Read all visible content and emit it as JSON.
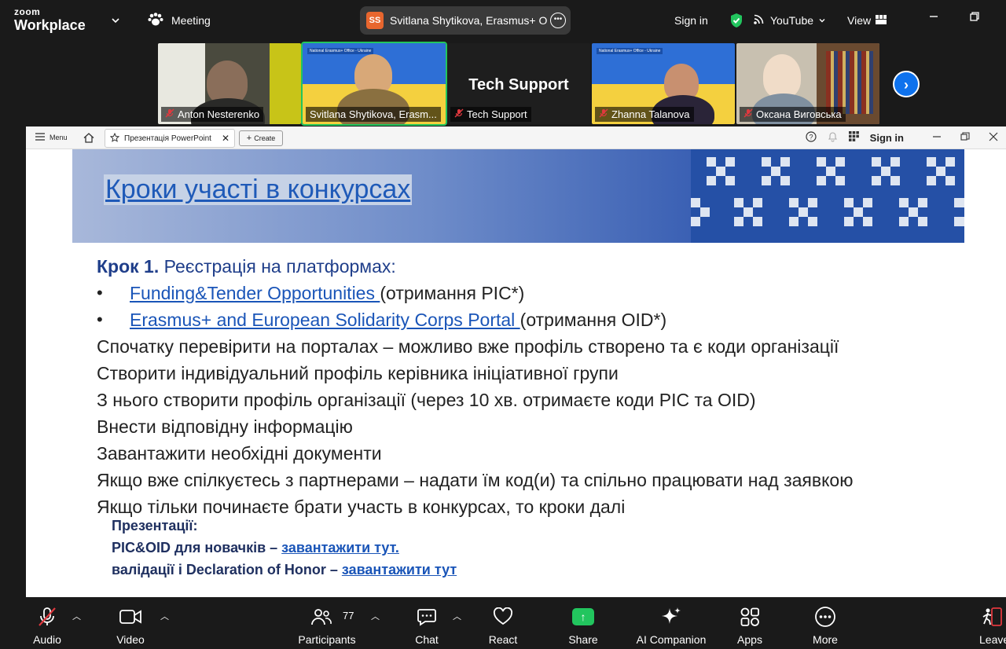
{
  "app": {
    "logo_line1": "zoom",
    "logo_line2": "Workplace"
  },
  "topbar": {
    "meeting_label": "Meeting",
    "active_speaker_initials": "SS",
    "active_speaker_text": "Svitlana Shytikova, Erasmus+ Offi",
    "sign_in": "Sign in",
    "youtube_label": "YouTube",
    "view_label": "View"
  },
  "participants": [
    {
      "name": "Anton Nesterenko"
    },
    {
      "name": "Svitlana Shytikova, Erasm..."
    },
    {
      "name": "Tech Support",
      "tile_text": "Tech Support"
    },
    {
      "name": "Zhanna Talanova"
    },
    {
      "name": "Оксана Виговська"
    }
  ],
  "flag_tile_label": "National Erasmus+ Office - Ukraine",
  "ppt_bar": {
    "menu_label": "Menu",
    "tab_label": "Презентація PowerPoint",
    "create_label": "Create",
    "sign_in": "Sign in"
  },
  "slide": {
    "title": "Кроки участі в конкурсах",
    "step_bold": "Крок 1.",
    "step_rest": " Реєстрація на платформах:",
    "bullet1_link": "Funding&Tender Opportunities ",
    "bullet1_rest": "(отримання PIC*)",
    "bullet2_link": "Erasmus+ and European Solidarity Corps Portal ",
    "bullet2_rest": "(отримання OID*)",
    "lines": [
      "Спочатку перевірити на порталах – можливо вже профіль створено та є коди організації",
      "Створити індивідуальний профіль керівника ініціативної групи",
      "З нього створити профіль організації (через 10 хв. отримаєте коди PIC та OID)",
      "Внести відповідну інформацію",
      "Завантажити необхідні документи",
      "Якщо вже спілкуєтесь з партнерами – надати їм код(и) та спільно працювати над заявкою",
      "Якщо тільки починаєте брати участь в конкурсах, то кроки далі"
    ],
    "pres_heading": "Презентації:",
    "pres1_text": "PIC&OID для новачків – ",
    "pres1_link": "завантажити тут.",
    "pres2_text": "валідації і Declaration of Honor – ",
    "pres2_link": "завантажити тут"
  },
  "toolbar": {
    "audio": "Audio",
    "video": "Video",
    "participants": "Participants",
    "participants_count": "77",
    "chat": "Chat",
    "react": "React",
    "share": "Share",
    "ai_companion": "AI Companion",
    "apps": "Apps",
    "more": "More",
    "leave": "Leave"
  },
  "colors": {
    "zoom_blue": "#0e72ed",
    "share_green": "#22c55e",
    "mute_red": "#e0383e",
    "slide_title_blue": "#1f5ab8",
    "slide_step_navy": "#1f3e8a"
  }
}
